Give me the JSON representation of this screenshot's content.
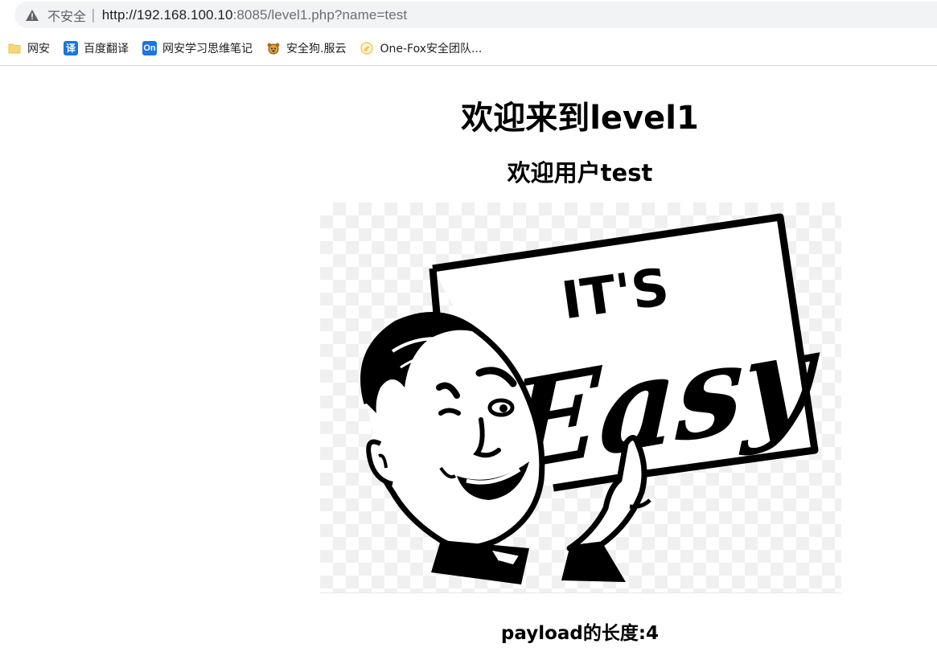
{
  "browser": {
    "security_label": "不安全",
    "separator": "|",
    "url_host": "http://192.168.100.10",
    "url_rest": ":8085/level1.php?name=test",
    "bookmarks": [
      {
        "label": "网安",
        "icon": "folder-icon"
      },
      {
        "label": "百度翻译",
        "icon": "yi-icon",
        "glyph": "译"
      },
      {
        "label": "网安学习思维笔记",
        "icon": "onenote-icon",
        "glyph": "On"
      },
      {
        "label": "安全狗.服云",
        "icon": "dog-icon"
      },
      {
        "label": "One-Fox安全团队...",
        "icon": "fox-icon"
      }
    ]
  },
  "page": {
    "title": "欢迎来到level1",
    "welcome": "欢迎用户test",
    "image_text": {
      "line1": "IT'S",
      "line2": "Easy"
    },
    "payload_length": "payload的长度:4"
  },
  "colors": {
    "omnibox_bg": "#f1f3f4",
    "url_host": "#202124",
    "url_rest": "#6b6f74"
  }
}
